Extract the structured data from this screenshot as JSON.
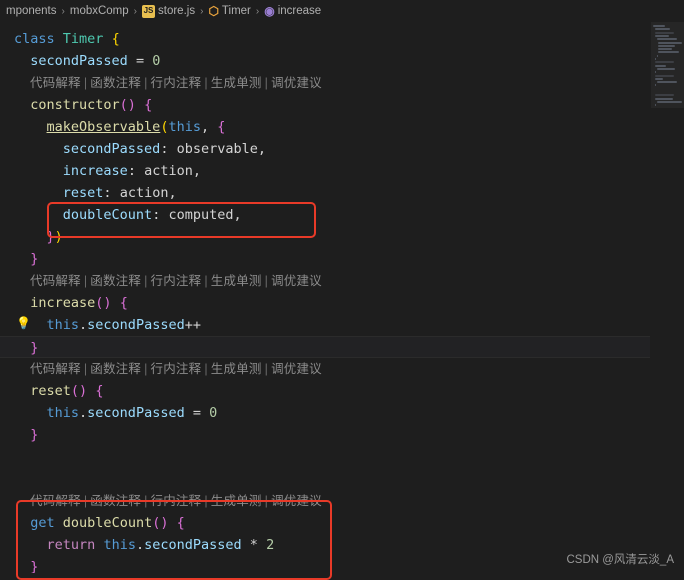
{
  "breadcrumb": {
    "items": [
      {
        "label": "mponents",
        "icon": "folder-icon",
        "icon_type": "none"
      },
      {
        "label": "mobxComp",
        "icon": "folder-icon",
        "icon_type": "none"
      },
      {
        "label": "store.js",
        "icon": "js-file-icon",
        "icon_type": "js"
      },
      {
        "label": "Timer",
        "icon": "class-icon",
        "icon_type": "cls"
      },
      {
        "label": "increase",
        "icon": "property-icon",
        "icon_type": "prop"
      }
    ],
    "separator": "›"
  },
  "hint_bar": {
    "items": [
      "代码解释",
      "函数注释",
      "行内注释",
      "生成单测",
      "调优建议"
    ],
    "separator": "|"
  },
  "code": {
    "lines": [
      {
        "id": "l1",
        "type": "code",
        "html": "<span class=\"kw\">class</span> <span class=\"cls\">Timer</span> <span class=\"br1\">{</span>"
      },
      {
        "id": "l2",
        "type": "code",
        "html": "  <span class=\"var\">secondPassed</span> <span class=\"op\">=</span> <span class=\"num\">0</span>"
      },
      {
        "id": "l3",
        "type": "hint"
      },
      {
        "id": "l4",
        "type": "code",
        "html": "  <span class=\"fn\">constructor</span><span class=\"br2\">()</span> <span class=\"br2\">{</span>"
      },
      {
        "id": "l5",
        "type": "code",
        "html": "    <span class=\"fn\" style=\"text-decoration:underline\">makeObservable</span><span class=\"br1\">(</span><span class=\"this\">this</span><span class=\"op\">,</span> <span class=\"br2\">{</span>"
      },
      {
        "id": "l6",
        "type": "code",
        "html": "      <span class=\"var\">secondPassed</span><span class=\"op\">:</span> <span class=\"pl\">observable</span><span class=\"op\">,</span>"
      },
      {
        "id": "l7",
        "type": "code",
        "html": "      <span class=\"var\">increase</span><span class=\"op\">:</span> <span class=\"pl\">action</span><span class=\"op\">,</span>"
      },
      {
        "id": "l8",
        "type": "code",
        "html": "      <span class=\"var\">reset</span><span class=\"op\">:</span> <span class=\"pl\">action</span><span class=\"op\">,</span>"
      },
      {
        "id": "l9",
        "type": "code",
        "html": "      <span class=\"var\">doubleCount</span><span class=\"op\">:</span> <span class=\"pl\">computed</span><span class=\"op\">,</span>"
      },
      {
        "id": "l10",
        "type": "code",
        "html": "    <span class=\"br2\">}</span><span class=\"br1\">)</span>"
      },
      {
        "id": "l11",
        "type": "code",
        "html": "  <span class=\"br2\">}</span>"
      },
      {
        "id": "l12",
        "type": "hint"
      },
      {
        "id": "l13",
        "type": "code",
        "html": "  <span class=\"fn\">increase</span><span class=\"br2\">()</span> <span class=\"br2\">{</span>"
      },
      {
        "id": "l14",
        "type": "code",
        "bulb": true,
        "html": "    <span class=\"this\">this</span><span class=\"op\">.</span><span class=\"var\">secondPassed</span><span class=\"op\">++</span>"
      },
      {
        "id": "l15",
        "type": "code",
        "highlight": true,
        "html": "  <span class=\"br2\">}</span>"
      },
      {
        "id": "l16",
        "type": "hint"
      },
      {
        "id": "l17",
        "type": "code",
        "html": "  <span class=\"fn\">reset</span><span class=\"br2\">()</span> <span class=\"br2\">{</span>"
      },
      {
        "id": "l18",
        "type": "code",
        "html": "    <span class=\"this\">this</span><span class=\"op\">.</span><span class=\"var\">secondPassed</span> <span class=\"op\">=</span> <span class=\"num\">0</span>"
      },
      {
        "id": "l19",
        "type": "code",
        "html": "  <span class=\"br2\">}</span>"
      },
      {
        "id": "l20",
        "type": "code",
        "html": ""
      },
      {
        "id": "l21",
        "type": "code",
        "html": ""
      },
      {
        "id": "l22",
        "type": "hint"
      },
      {
        "id": "l23",
        "type": "code",
        "html": "  <span class=\"kw\">get</span> <span class=\"fn\">doubleCount</span><span class=\"br2\">()</span> <span class=\"br2\">{</span>"
      },
      {
        "id": "l24",
        "type": "code",
        "html": "    <span class=\"kw2\">return</span> <span class=\"this\">this</span><span class=\"op\">.</span><span class=\"var\">secondPassed</span> <span class=\"op\">*</span> <span class=\"num\">2</span>"
      },
      {
        "id": "l25",
        "type": "code",
        "html": "  <span class=\"br2\">}</span>"
      }
    ]
  },
  "annotations": {
    "boxes": [
      {
        "id": "redbox-1",
        "label": "doubleCount-computed-highlight",
        "color": "#e83a28"
      },
      {
        "id": "redbox-2",
        "label": "get-doubleCount-highlight",
        "color": "#e83a28"
      }
    ]
  },
  "watermark": {
    "text": "CSDN @风清云淡_A"
  },
  "colors": {
    "background": "#1e1e1e",
    "annotation": "#e83a28",
    "keyword": "#569cd6",
    "function": "#dcdcaa",
    "variable": "#9cdcfe",
    "number": "#b5cea8",
    "class": "#4ec9b0",
    "hint": "#8c8c8c"
  }
}
